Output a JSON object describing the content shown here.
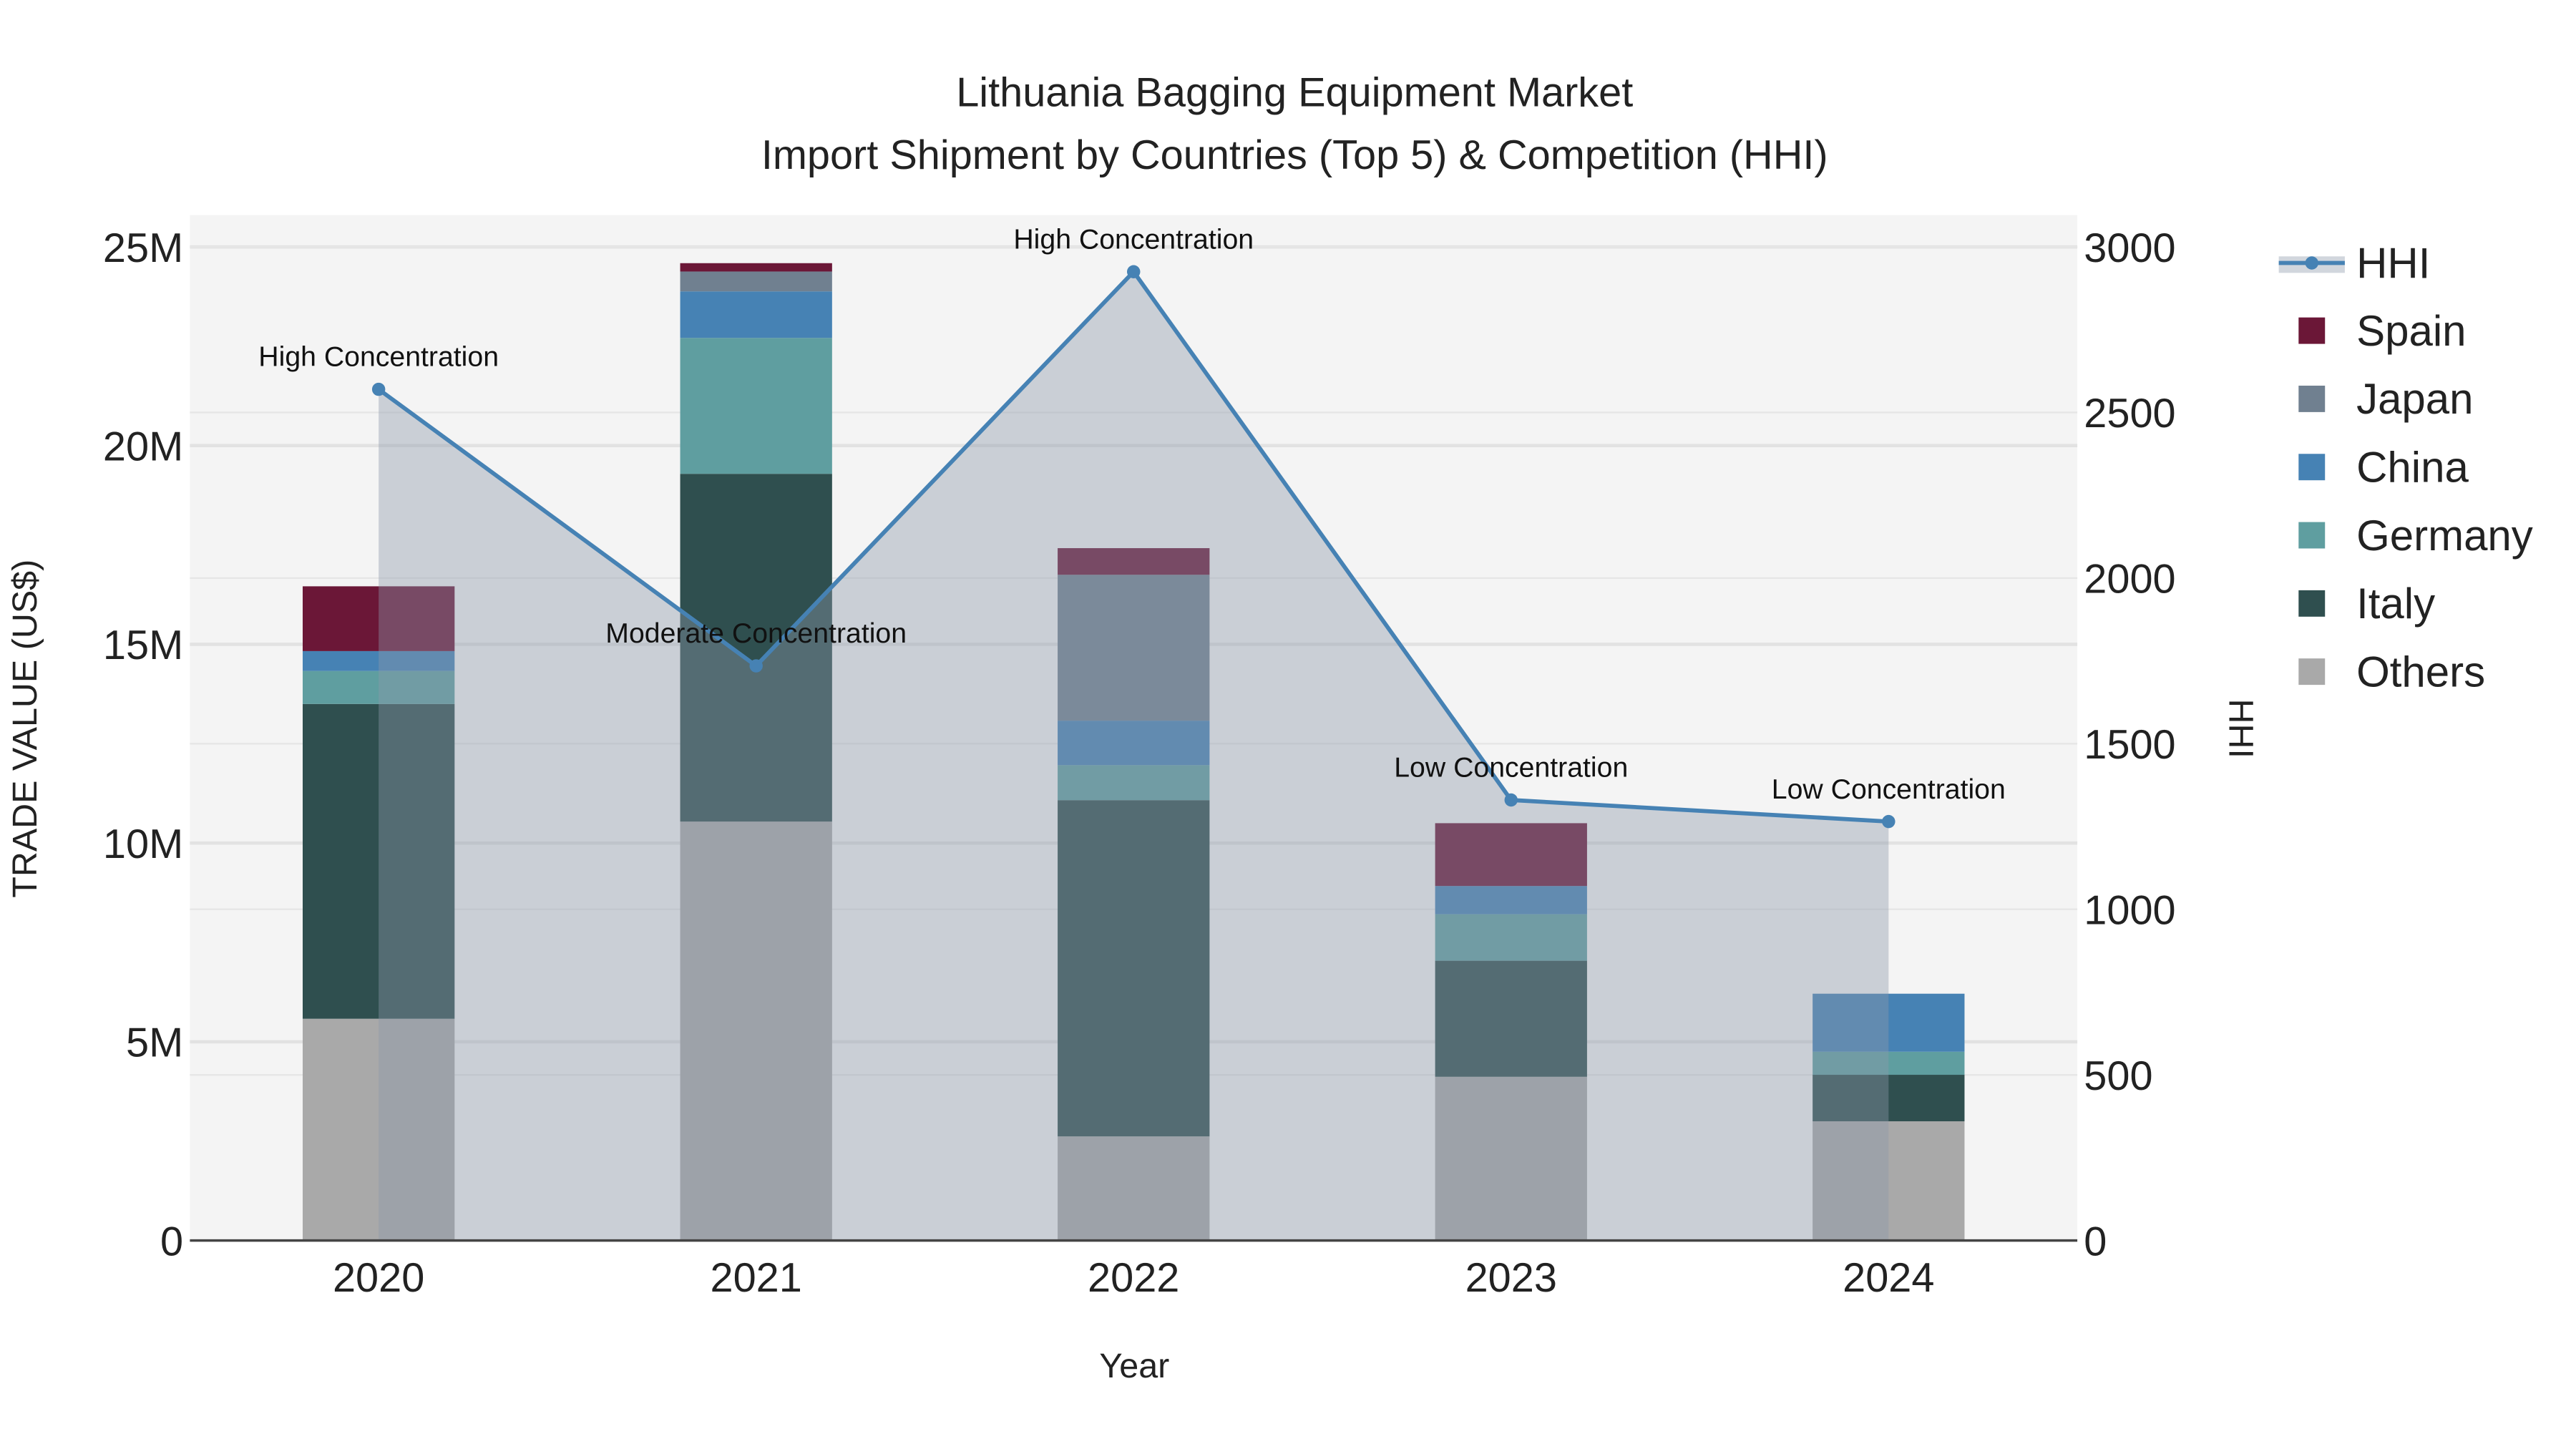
{
  "chart_data": {
    "type": "bar",
    "title": "Lithuania Bagging Equipment Market",
    "subtitle": "Import Shipment by Countries (Top 5) & Competition (HHI)",
    "xlabel": "Year",
    "ylabel": "TRADE VALUE (US$)",
    "y2label": "HHI",
    "categories": [
      "2020",
      "2021",
      "2022",
      "2023",
      "2024"
    ],
    "ylim": [
      0,
      25800000
    ],
    "y2lim": [
      0,
      3096
    ],
    "yticks": [
      {
        "v": 0,
        "label": "0"
      },
      {
        "v": 5000000,
        "label": "5M"
      },
      {
        "v": 10000000,
        "label": "10M"
      },
      {
        "v": 15000000,
        "label": "15M"
      },
      {
        "v": 20000000,
        "label": "20M"
      },
      {
        "v": 25000000,
        "label": "25M"
      }
    ],
    "y2ticks": [
      {
        "v": 0,
        "label": "0"
      },
      {
        "v": 500,
        "label": "500"
      },
      {
        "v": 1000,
        "label": "1000"
      },
      {
        "v": 1500,
        "label": "1500"
      },
      {
        "v": 2000,
        "label": "2000"
      },
      {
        "v": 2500,
        "label": "2500"
      },
      {
        "v": 3000,
        "label": "3000"
      }
    ],
    "series": [
      {
        "name": "Others",
        "color": "#a9a9a9",
        "values": [
          5580000,
          10540000,
          2620000,
          4120000,
          3000000
        ]
      },
      {
        "name": "Italy",
        "color": "#2f4f4f",
        "values": [
          7920000,
          8750000,
          8460000,
          2920000,
          1170000
        ]
      },
      {
        "name": "Germany",
        "color": "#5f9ea0",
        "values": [
          830000,
          3420000,
          880000,
          1170000,
          580000
        ]
      },
      {
        "name": "China",
        "color": "#4682b4",
        "values": [
          500000,
          1170000,
          1120000,
          710000,
          1460000
        ]
      },
      {
        "name": "Japan",
        "color": "#708090",
        "values": [
          0,
          500000,
          3670000,
          0,
          0
        ]
      },
      {
        "name": "Spain",
        "color": "#6b1737",
        "values": [
          1630000,
          210000,
          670000,
          1580000,
          0
        ]
      }
    ],
    "hhi": {
      "name": "HHI",
      "color": "#4682b4",
      "values": [
        2570,
        1735,
        2925,
        1330,
        1265
      ]
    },
    "annotations": [
      "High Concentration",
      "Moderate Concentration",
      "High Concentration",
      "Low Concentration",
      "Low Concentration"
    ],
    "legend": {
      "placement": "right",
      "order": [
        "HHI",
        "Spain",
        "Japan",
        "China",
        "Germany",
        "Italy",
        "Others"
      ]
    },
    "grid": true
  }
}
